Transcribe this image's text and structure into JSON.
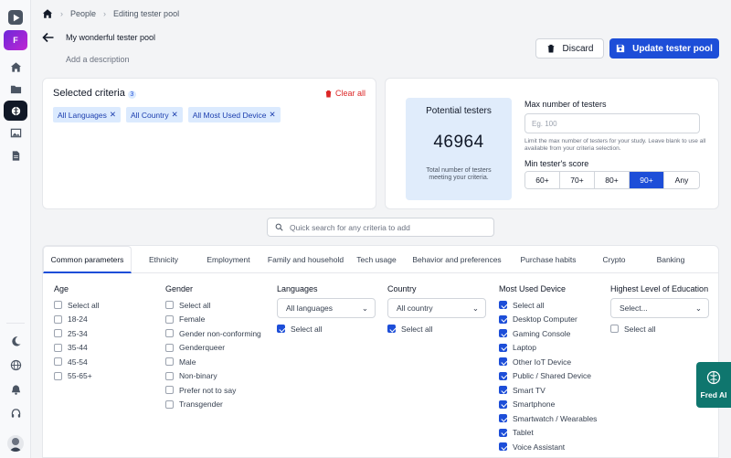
{
  "sidebar": {
    "brand_letter": "F",
    "icons": [
      "play-logo-icon",
      "home-icon",
      "folder-icon",
      "brain-icon",
      "image-icon",
      "document-icon",
      "moon-icon",
      "globe-icon",
      "bell-icon",
      "headset-icon"
    ]
  },
  "breadcrumb": {
    "people": "People",
    "current": "Editing tester pool"
  },
  "header": {
    "title": "My wonderful tester pool",
    "description_placeholder": "Add a description",
    "discard_label": "Discard",
    "update_label": "Update tester pool"
  },
  "criteria": {
    "title": "Selected criteria",
    "count": "3",
    "clear_label": "Clear all",
    "chips": [
      "All Languages",
      "All Country",
      "All Most Used Device"
    ]
  },
  "potential": {
    "title": "Potential testers",
    "value": "46964",
    "subtitle_line1": "Total number of testers",
    "subtitle_line2": "meeting your criteria.",
    "max_label": "Max number of testers",
    "max_placeholder": "Eg. 100",
    "max_help": "Limit the max number of testers for your study. Leave blank to use all available from your criteria selection.",
    "score_label": "Min tester's score",
    "score_options": [
      "60+",
      "70+",
      "80+",
      "90+",
      "Any"
    ],
    "score_selected": "90+"
  },
  "search": {
    "placeholder": "Quick search for any criteria to add"
  },
  "tabs": [
    {
      "label": "Common parameters",
      "active": true
    },
    {
      "label": "Ethnicity"
    },
    {
      "label": "Employment"
    },
    {
      "label": "Family and household"
    },
    {
      "label": "Tech usage"
    },
    {
      "label": "Behavior and preferences"
    },
    {
      "label": "Purchase habits"
    },
    {
      "label": "Crypto"
    },
    {
      "label": "Banking"
    }
  ],
  "age": {
    "title": "Age",
    "options": [
      "Select all",
      "18-24",
      "25-34",
      "35-44",
      "45-54",
      "55-65+"
    ]
  },
  "gender": {
    "title": "Gender",
    "options": [
      "Select all",
      "Female",
      "Gender non-conforming",
      "Genderqueer",
      "Male",
      "Non-binary",
      "Prefer not to say",
      "Transgender"
    ]
  },
  "languages": {
    "title": "Languages",
    "selected": "All languages",
    "select_all": "Select all"
  },
  "country": {
    "title": "Country",
    "selected": "All country",
    "select_all": "Select all"
  },
  "device": {
    "title": "Most Used Device",
    "options": [
      "Select all",
      "Desktop Computer",
      "Gaming Console",
      "Laptop",
      "Other IoT Device",
      "Public / Shared Device",
      "Smart TV",
      "Smartphone",
      "Smartwatch / Wearables",
      "Tablet",
      "Voice Assistant"
    ]
  },
  "education": {
    "title": "Highest Level of Education",
    "selected": "Select...",
    "select_all": "Select all"
  },
  "fred": {
    "label": "Fred AI"
  },
  "colors": {
    "primary": "#1d4ed8",
    "danger": "#dc2626",
    "chip_bg": "#dbeafe",
    "fred": "#0f766e"
  }
}
